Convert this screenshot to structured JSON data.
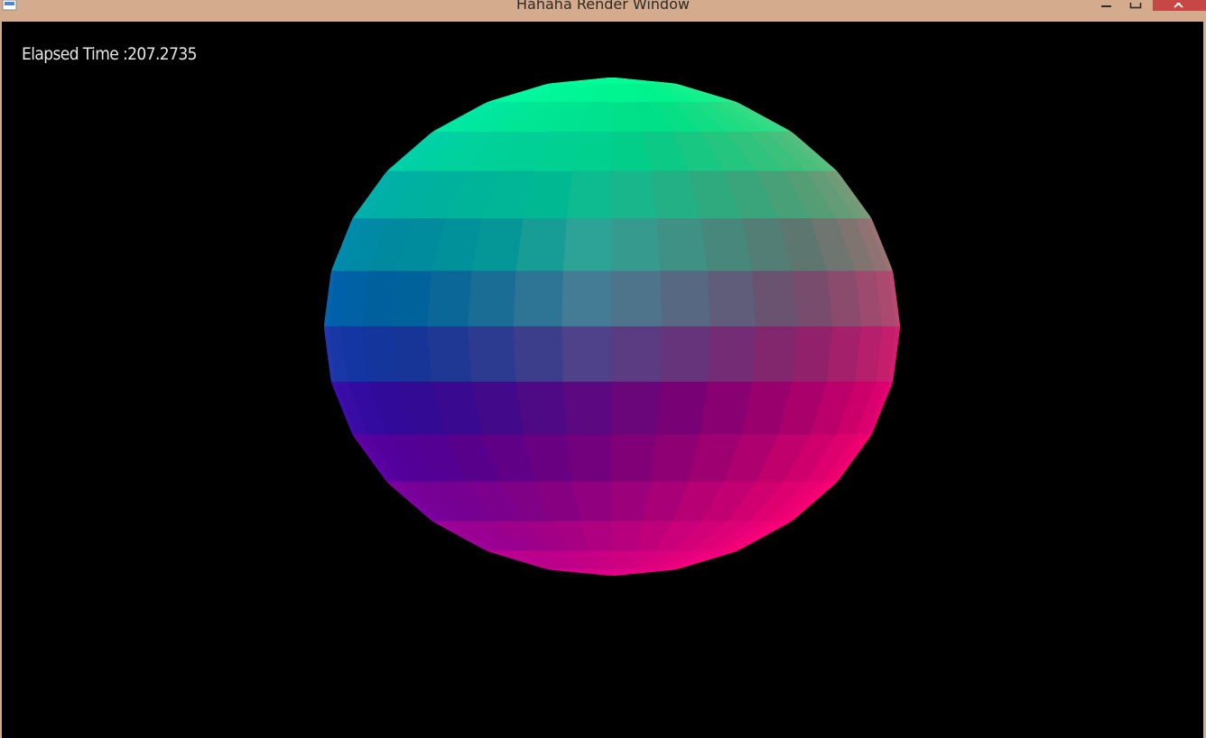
{
  "window": {
    "title": "Hahaha Render Window",
    "frame_color": "#d4ab8c",
    "close_color": "#c74747",
    "controls": {
      "minimize_icon": "minimize-icon",
      "maximize_icon": "maximize-icon",
      "close_icon": "close-icon"
    }
  },
  "viewport": {
    "background": "#000000",
    "overlay_text": "Elapsed Time :207.2735",
    "object": "sphere",
    "shading": "rainbow-faceted"
  }
}
